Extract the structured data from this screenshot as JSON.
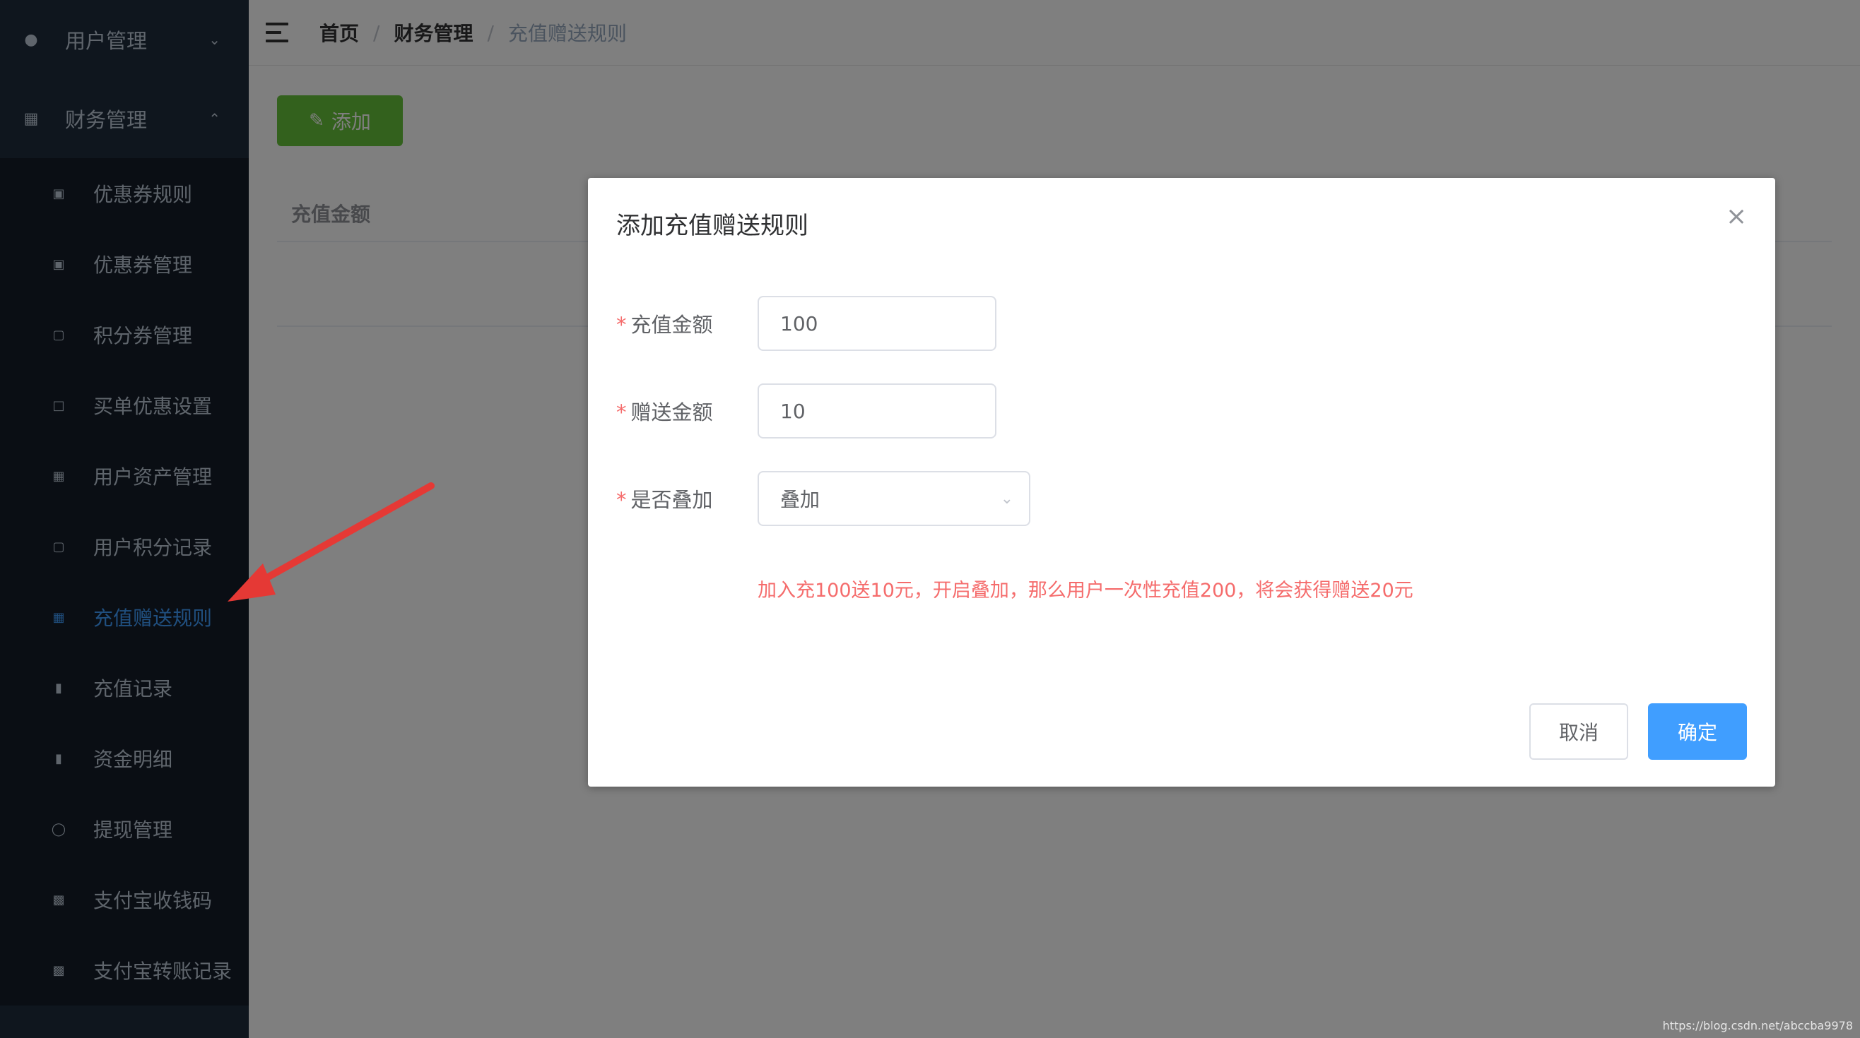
{
  "sidebar": {
    "groups": [
      {
        "label": "用户管理",
        "icon": "user-icon",
        "chevron": "chevron-down"
      },
      {
        "label": "财务管理",
        "icon": "finance-icon",
        "chevron": "chevron-up"
      }
    ],
    "items": [
      {
        "label": "优惠券规则",
        "icon": "coupon-icon"
      },
      {
        "label": "优惠券管理",
        "icon": "coupon-icon"
      },
      {
        "label": "积分券管理",
        "icon": "points-icon"
      },
      {
        "label": "买单优惠设置",
        "icon": "wallet-icon"
      },
      {
        "label": "用户资产管理",
        "icon": "asset-icon"
      },
      {
        "label": "用户积分记录",
        "icon": "points-icon"
      },
      {
        "label": "充值赠送规则",
        "icon": "asset-icon",
        "active": true
      },
      {
        "label": "充值记录",
        "icon": "doc-icon"
      },
      {
        "label": "资金明细",
        "icon": "doc-icon"
      },
      {
        "label": "提现管理",
        "icon": "withdraw-icon"
      },
      {
        "label": "支付宝收钱码",
        "icon": "alipay-icon"
      },
      {
        "label": "支付宝转账记录",
        "icon": "alipay-icon"
      }
    ],
    "active_color": "#409eff"
  },
  "header": {
    "breadcrumb": [
      "首页",
      "财务管理",
      "充值赠送规则"
    ],
    "separator": "/"
  },
  "content": {
    "add_label": "添加",
    "table_header": "充值金额"
  },
  "dialog": {
    "title": "添加充值赠送规则",
    "fields": {
      "recharge": {
        "label": "充值金额",
        "value": "100"
      },
      "gift": {
        "label": "赠送金额",
        "value": "10"
      },
      "stack": {
        "label": "是否叠加",
        "value": "叠加"
      }
    },
    "required_mark": "*",
    "hint": "加入充100送10元，开启叠加，那么用户一次性充值200，将会获得赠送20元",
    "cancel_label": "取消",
    "confirm_label": "确定"
  },
  "watermark": "https://blog.csdn.net/abccba9978"
}
